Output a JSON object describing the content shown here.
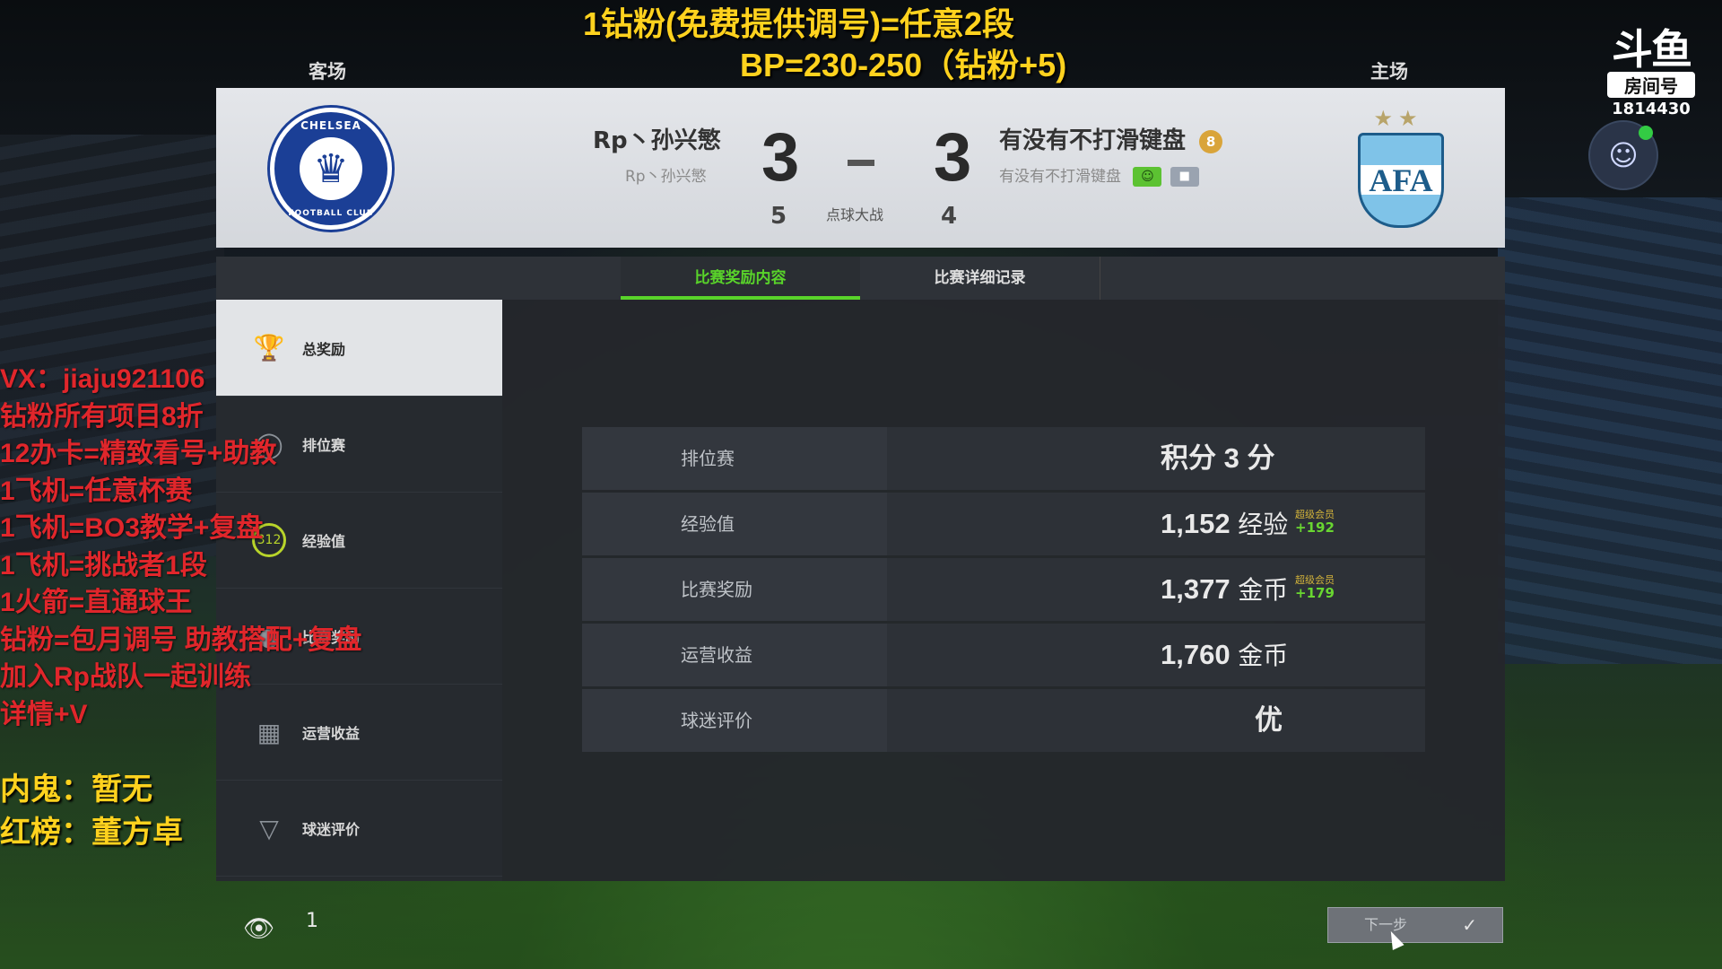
{
  "stream_overlay": {
    "top_line1": "1钻粉(免费提供调号)=任意2段",
    "top_line2": "BP=230-250（钻粉+5)",
    "left_lines": [
      "VX：jiaju921106",
      "钻粉所有项目8折",
      "12办卡=精致看号+助教",
      "1飞机=任意杯赛",
      "1飞机=BO3教学+复盘",
      "1飞机=挑战者1段",
      "1火箭=直通球王",
      "钻粉=包月调号  助教搭配+复盘",
      "加入Rp战队一起训练",
      "详情+V"
    ],
    "left_lines2": [
      "内鬼：暂无",
      "红榜：董方卓"
    ]
  },
  "douyu": {
    "logo": "斗鱼",
    "room_label": "房间号",
    "room_number": "1814430"
  },
  "match": {
    "away_label": "客场",
    "home_label": "主场",
    "away_team_name": "Rp丶孙兴慜",
    "away_team_sub": "Rp丶孙兴慜",
    "home_team_name": "有没有不打滑键盘",
    "home_team_sub": "有没有不打滑键盘",
    "away_score": "3",
    "home_score": "3",
    "away_pk": "5",
    "home_pk": "4",
    "pk_label": "点球大战",
    "away_crest_top": "CHELSEA",
    "away_crest_bottom": "FOOTBALL CLUB",
    "home_crest_text": "AFA",
    "home_medal": "8"
  },
  "tabs": {
    "rewards": "比赛奖励内容",
    "details": "比赛详细记录"
  },
  "sidebar": [
    {
      "label": "总奖励",
      "icon": "trophy-icon"
    },
    {
      "label": "排位赛",
      "icon": "rank-icon"
    },
    {
      "label": "经验值",
      "icon": "xp-icon"
    },
    {
      "label": "比赛奖励",
      "icon": "coins-icon"
    },
    {
      "label": "运营收益",
      "icon": "stadium-icon"
    },
    {
      "label": "球迷评价",
      "icon": "fan-icon"
    }
  ],
  "xp_icon_text": "312",
  "rewards": [
    {
      "name": "排位赛",
      "value": "积分 3 分"
    },
    {
      "name": "经验值",
      "value": "1,152",
      "unit": "经验",
      "bonus_label": "超级会员",
      "bonus": "+192"
    },
    {
      "name": "比赛奖励",
      "value": "1,377",
      "unit": "金币",
      "bonus_label": "超级会员",
      "bonus": "+179"
    },
    {
      "name": "运营收益",
      "value": "1,760",
      "unit": "金币"
    },
    {
      "name": "球迷评价",
      "value": "优"
    }
  ],
  "bottom": {
    "viewer_count": "1",
    "next_label": "下一步"
  },
  "colors": {
    "accent_green": "#59d42a",
    "overlay_yellow": "#ffd21e",
    "overlay_red": "#e0262b"
  }
}
